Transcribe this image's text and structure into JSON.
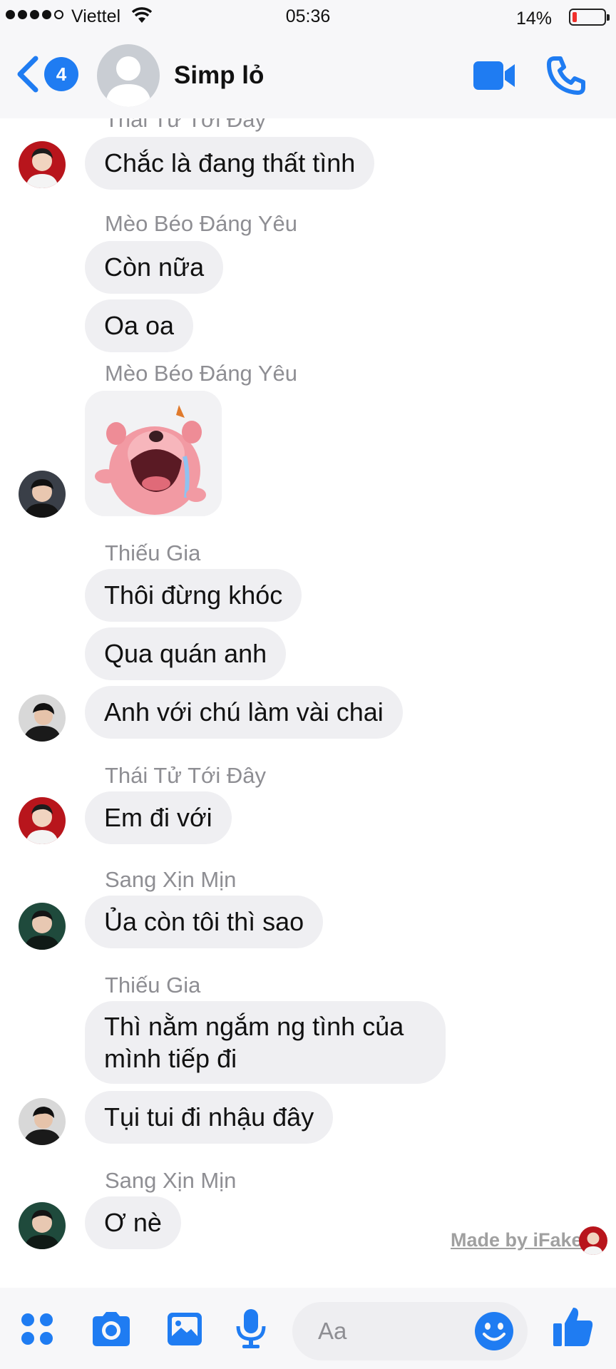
{
  "status_bar": {
    "carrier": "Viettel",
    "time": "05:36",
    "battery_percent": "14%",
    "battery_level": 0.14
  },
  "header": {
    "unread_count": "4",
    "title": "Simp lỏ"
  },
  "messages": [
    {
      "sender": "Thái Tử Tới Đây",
      "text": "Chắc là đang thất tình"
    },
    {
      "sender": "Mèo Béo Đáng Yêu",
      "text": "Còn nữa"
    },
    {
      "text": "Oa oa"
    },
    {
      "sender": "Mèo Béo Đáng Yêu",
      "sticker": "crying-pink-beaver-sticker"
    },
    {
      "sender": "Thiếu Gia",
      "text": "Thôi đừng khóc"
    },
    {
      "text": "Qua quán anh"
    },
    {
      "text": "Anh với chú làm vài chai"
    },
    {
      "sender": "Thái Tử Tới Đây",
      "text": "Em đi với"
    },
    {
      "sender": "Sang Xịn Mịn",
      "text": "Ủa còn tôi thì sao"
    },
    {
      "sender": "Thiếu Gia",
      "text": "Thì nằm ngắm ng tình của mình tiếp đi"
    },
    {
      "text": "Tụi tui đi nhậu đây"
    },
    {
      "sender": "Sang Xịn Mịn",
      "text": "Ơ nè"
    }
  ],
  "watermark": "Made by iFake",
  "composer": {
    "placeholder": "Aa"
  },
  "colors": {
    "accent": "#1f7cf2",
    "bubble": "#efeff2",
    "sender_name": "#8e8e93"
  }
}
